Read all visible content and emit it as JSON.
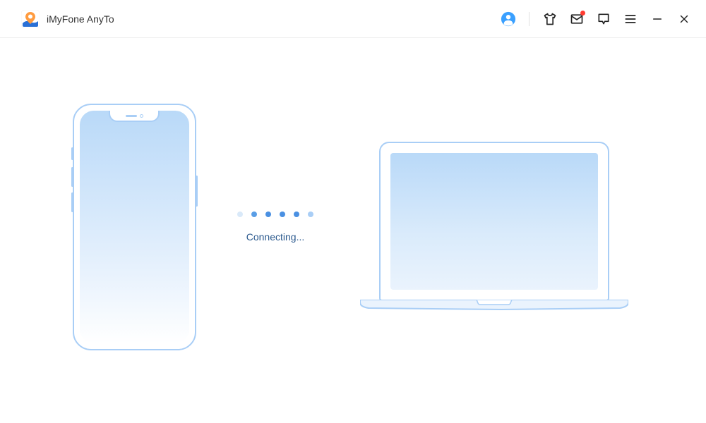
{
  "app": {
    "title": "iMyFone AnyTo"
  },
  "titlebar": {
    "icons": {
      "account": "account-icon",
      "tshirt": "tshirt-icon",
      "mail": "mail-icon",
      "feedback": "feedback-icon",
      "menu": "menu-icon",
      "minimize": "minimize-icon",
      "close": "close-icon"
    }
  },
  "status": {
    "connecting_label": "Connecting..."
  },
  "colors": {
    "accent_blue": "#4a90e2",
    "light_blue": "#a9cef6",
    "text_dark": "#333333",
    "notification_red": "#ff3b30"
  }
}
